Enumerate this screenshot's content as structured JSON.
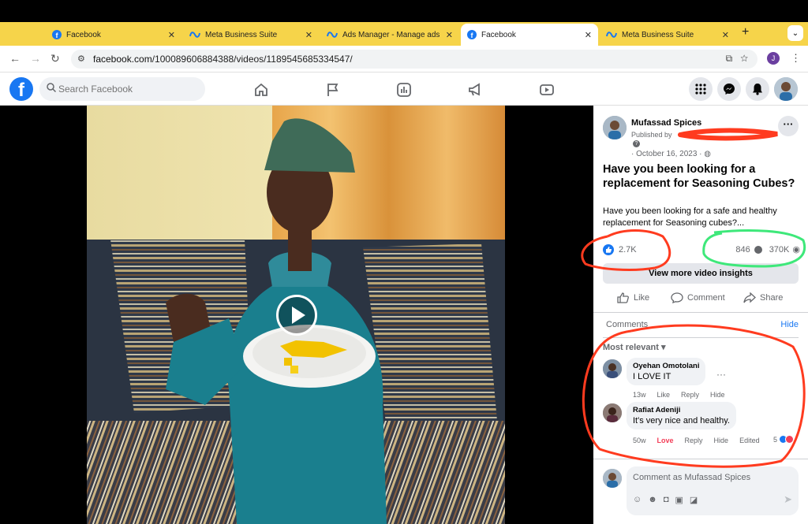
{
  "browser": {
    "tabs": [
      {
        "title": "Facebook",
        "icon": "facebook-icon"
      },
      {
        "title": "Meta Business Suite",
        "icon": "meta-icon"
      },
      {
        "title": "Ads Manager - Manage ads",
        "icon": "meta-icon"
      },
      {
        "title": "Facebook",
        "icon": "facebook-icon",
        "active": true
      },
      {
        "title": "Meta Business Suite",
        "icon": "meta-icon"
      }
    ],
    "url_domain": "facebook.com",
    "url_path": "/100089606884388/videos/1189545685334547/",
    "profile_initial": "J",
    "tabstrip_color": "#f6d44a"
  },
  "fb_header": {
    "logo": "f",
    "search_placeholder": "Search Facebook",
    "brand_color": "#1877f2"
  },
  "post": {
    "page_name": "Mufassad Spices",
    "published_by": "Published by",
    "date": "· October 16, 2023 ·",
    "title": "Have you been looking for a replacement for Seasoning Cubes?",
    "description": "Have you been looking for a safe and healthy replacement for Seasoning cubes?...",
    "likes": "2.7K",
    "comments_count": "846",
    "views": "370K",
    "insights_label": "View more video insights",
    "actions": {
      "like": "Like",
      "comment": "Comment",
      "share": "Share"
    }
  },
  "comments": {
    "header": "Comments",
    "hide_label": "Hide",
    "sort_label": "Most relevant",
    "items": [
      {
        "author": "Oyehan Omotolani",
        "text": "I LOVE IT",
        "age": "13w",
        "like": "Like",
        "reply": "Reply",
        "hide": "Hide"
      },
      {
        "author": "Rafiat Adeniji",
        "text": "It's very nice and healthy.",
        "age": "50w",
        "love": "Love",
        "reply": "Reply",
        "hide": "Hide",
        "edited": "Edited",
        "reactions": "5"
      }
    ],
    "composer_placeholder": "Comment as Mufassad Spices"
  },
  "annotations": {
    "red": "#ff3b1f",
    "green": "#3ee87a"
  }
}
